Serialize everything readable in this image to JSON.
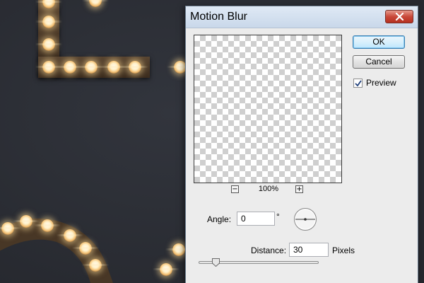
{
  "dialog": {
    "title": "Motion Blur",
    "close_icon": "close-icon",
    "ok_label": "OK",
    "cancel_label": "Cancel",
    "preview_label": "Preview",
    "preview_checked": true,
    "zoom_out_label": "−",
    "zoom_in_label": "+",
    "zoom_level": "100%",
    "angle_label": "Angle:",
    "angle_value": "0",
    "angle_unit": "°",
    "distance_label": "Distance:",
    "distance_value": "30",
    "distance_unit": "Pixels",
    "distance_slider_fraction": 0.14
  },
  "colors": {
    "canvas_background": "#2c2f36",
    "bulb_glow": "#fff0c8",
    "strip": "#4a3826",
    "close_button": "#c9493a",
    "ok_button_border": "#3c7fb1"
  }
}
